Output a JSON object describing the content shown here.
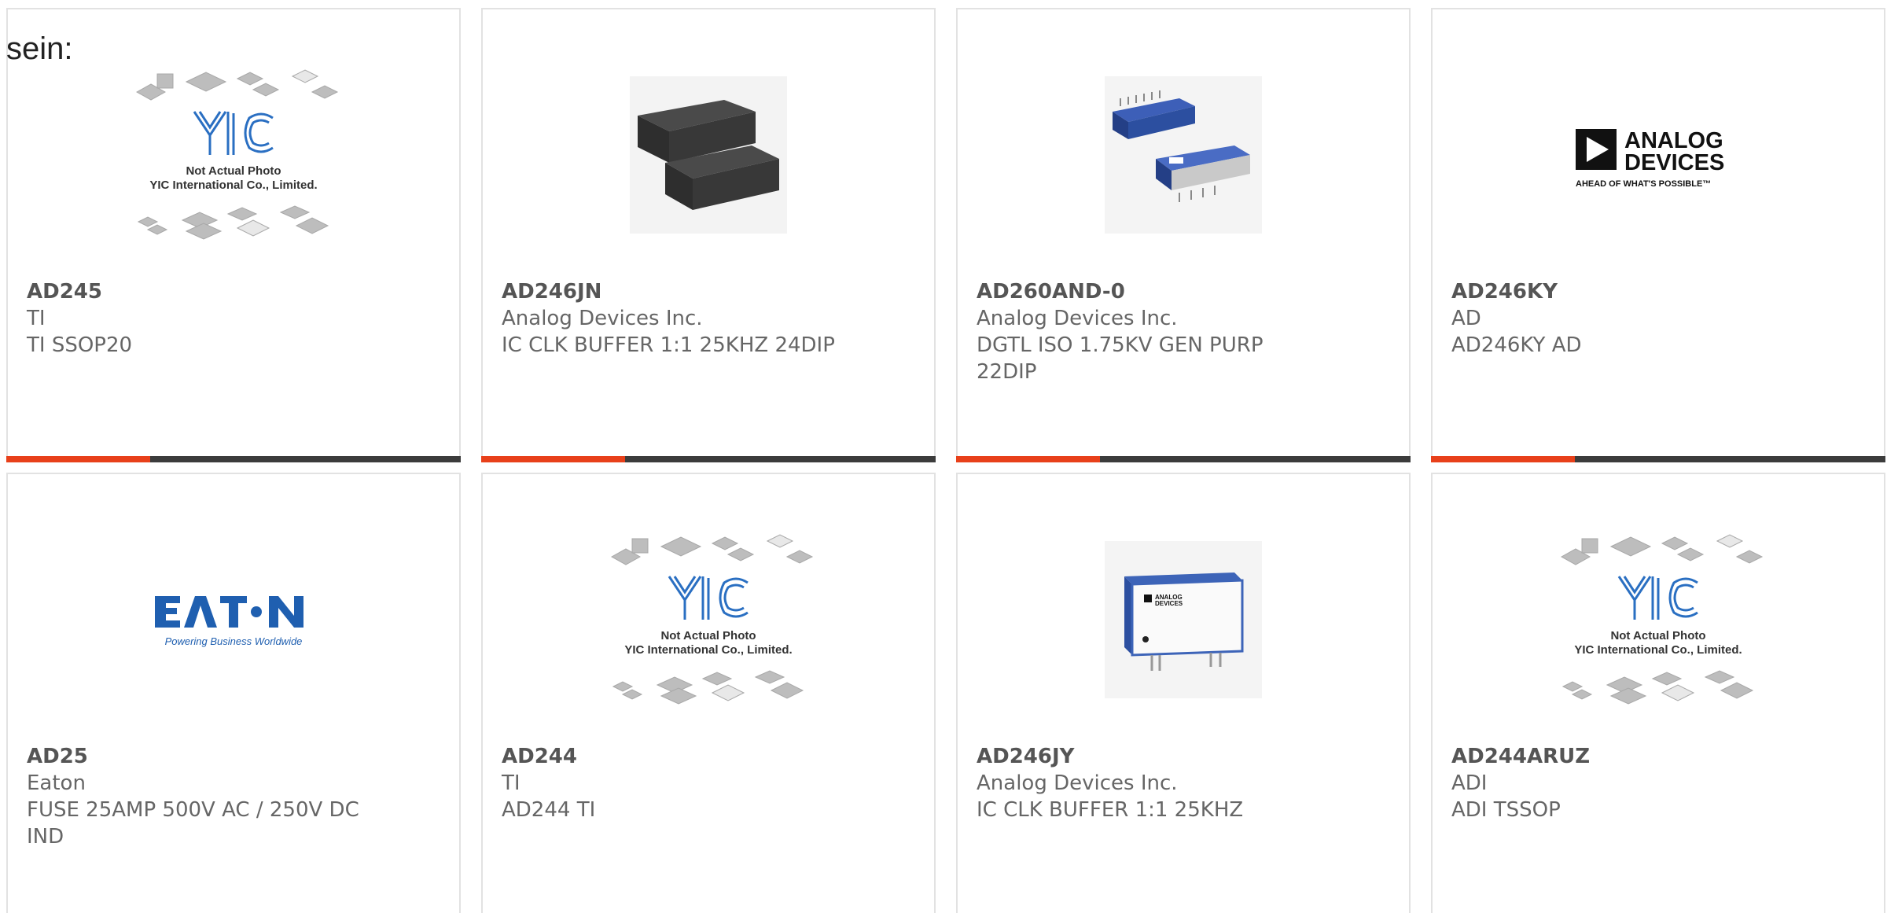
{
  "intro_text": "sein:",
  "products": [
    {
      "part": "AD245",
      "manufacturer": "TI",
      "description": "TI SSOP20",
      "image": "yic-placeholder-image",
      "photo_note_line1": "Not Actual Photo",
      "photo_note_line2": "YIC International Co., Limited."
    },
    {
      "part": "AD246JN",
      "manufacturer": "Analog Devices Inc.",
      "description": "IC CLK BUFFER 1:1 25KHZ 24DIP",
      "image": "black-dip-module-photo"
    },
    {
      "part": "AD260AND-0",
      "manufacturer": "Analog Devices Inc.",
      "description": "DGTL ISO 1.75KV GEN PURP 22DIP",
      "image": "blue-isolator-module-photo"
    },
    {
      "part": "AD246KY",
      "manufacturer": "AD",
      "description": "AD246KY AD",
      "image": "analog-devices-logo",
      "logo_line1": "ANALOG",
      "logo_line2": "DEVICES",
      "logo_tagline": "AHEAD OF WHAT'S POSSIBLE™"
    },
    {
      "part": "AD25",
      "manufacturer": "Eaton",
      "description": "FUSE 25AMP 500V AC / 250V DC IND",
      "image": "eaton-logo",
      "logo_tagline": "Powering Business Worldwide"
    },
    {
      "part": "AD244",
      "manufacturer": "TI",
      "description": "AD244 TI",
      "image": "yic-placeholder-image",
      "photo_note_line1": "Not Actual Photo",
      "photo_note_line2": "YIC International Co., Limited."
    },
    {
      "part": "AD246JY",
      "manufacturer": "Analog Devices Inc.",
      "description": "IC CLK BUFFER 1:1 25KHZ",
      "image": "white-module-photo",
      "module_label_line1": "ANALOG",
      "module_label_line2": "DEVICES"
    },
    {
      "part": "AD244ARUZ",
      "manufacturer": "ADI",
      "description": "ADI TSSOP",
      "image": "yic-placeholder-image",
      "photo_note_line1": "Not Actual Photo",
      "photo_note_line2": "YIC International Co., Limited."
    }
  ],
  "colors": {
    "accent_red": "#e8401a",
    "accent_dark": "#3c3c3c",
    "card_border": "#e2e2e2",
    "eaton_blue": "#1f5fb0",
    "yic_blue": "#2a6fc2",
    "module_blue": "#2c4fa0"
  }
}
